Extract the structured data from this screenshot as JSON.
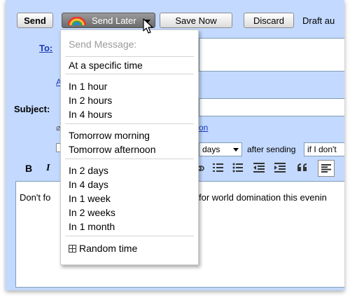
{
  "toolbar": {
    "send": "Send",
    "send_later": "Send Later",
    "save_now": "Save Now",
    "discard": "Discard",
    "draft_status": "Draft au"
  },
  "compose": {
    "to_label": "To:",
    "add_cc": "A",
    "subject_label": "Subject:",
    "attach_link": "on",
    "days_select_value": "days",
    "after_sending": "after sending",
    "condition_value": "if I don't",
    "format_bold": "B",
    "format_italic": "I",
    "body_left": "Don't fo",
    "body_right": "for world domination this evenin"
  },
  "menu": {
    "header": "Send Message:",
    "specific": "At a specific time",
    "hours": [
      "In 1 hour",
      "In 2 hours",
      "In 4 hours"
    ],
    "tomorrow": [
      "Tomorrow morning",
      "Tomorrow afternoon"
    ],
    "days": [
      "In 2 days",
      "In 4 days",
      "In 1 week",
      "In 2 weeks",
      "In 1 month"
    ],
    "random": "Random time"
  },
  "icons": {
    "logo": "rainbow-arc-logo",
    "cursor": "mouse-pointer-icon",
    "random": "grid-icon"
  },
  "colors": {
    "background": "#c3d9ff",
    "link": "#1a3bb8",
    "menu_header": "#9a9a9a"
  }
}
